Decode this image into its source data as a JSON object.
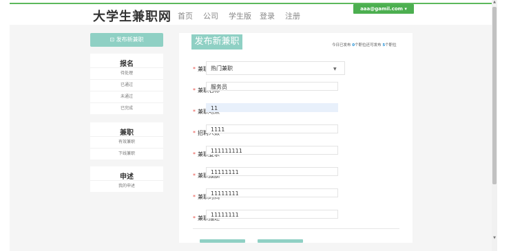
{
  "header": {
    "brand": "大学生兼职网",
    "nav": [
      "首页",
      "公司",
      "学生版",
      "登录",
      "注册"
    ],
    "user_email": "aaa@gamil.com ▾"
  },
  "sidebar": {
    "publish_label": "⊡ 发布新兼职",
    "groups": [
      {
        "title": "报名",
        "items": [
          "待处理",
          "已通过",
          "未通过",
          "已完成"
        ]
      },
      {
        "title": "兼职",
        "items": [
          "有效兼职",
          "下线兼职"
        ]
      },
      {
        "title": "申述",
        "items": [
          "我的申述"
        ]
      }
    ]
  },
  "form": {
    "tab_title": "发布新兼职",
    "stats": {
      "prefix": "今日已发布 ",
      "published": "0",
      "mid": "个职位还可发布 ",
      "remaining": "5",
      "suffix": "个职位"
    },
    "fields": [
      {
        "label": "兼职类型",
        "value": "热门兼职"
      },
      {
        "label": "兼职名称",
        "value": "服务员"
      },
      {
        "label": "兼职地点",
        "value": "11"
      },
      {
        "label": "招聘人数",
        "value": "1111"
      },
      {
        "label": "兼职要求",
        "value": "111111111"
      },
      {
        "label": "兼职报酬",
        "value": "11111111"
      },
      {
        "label": "兼职时间",
        "value": "11111111"
      },
      {
        "label": "兼职描述",
        "value": "11111111"
      }
    ]
  },
  "colors": {
    "accent": "#8fd0c4",
    "topline": "#5cb85c",
    "user_btn": "#4caf50",
    "required": "#e8514a"
  }
}
